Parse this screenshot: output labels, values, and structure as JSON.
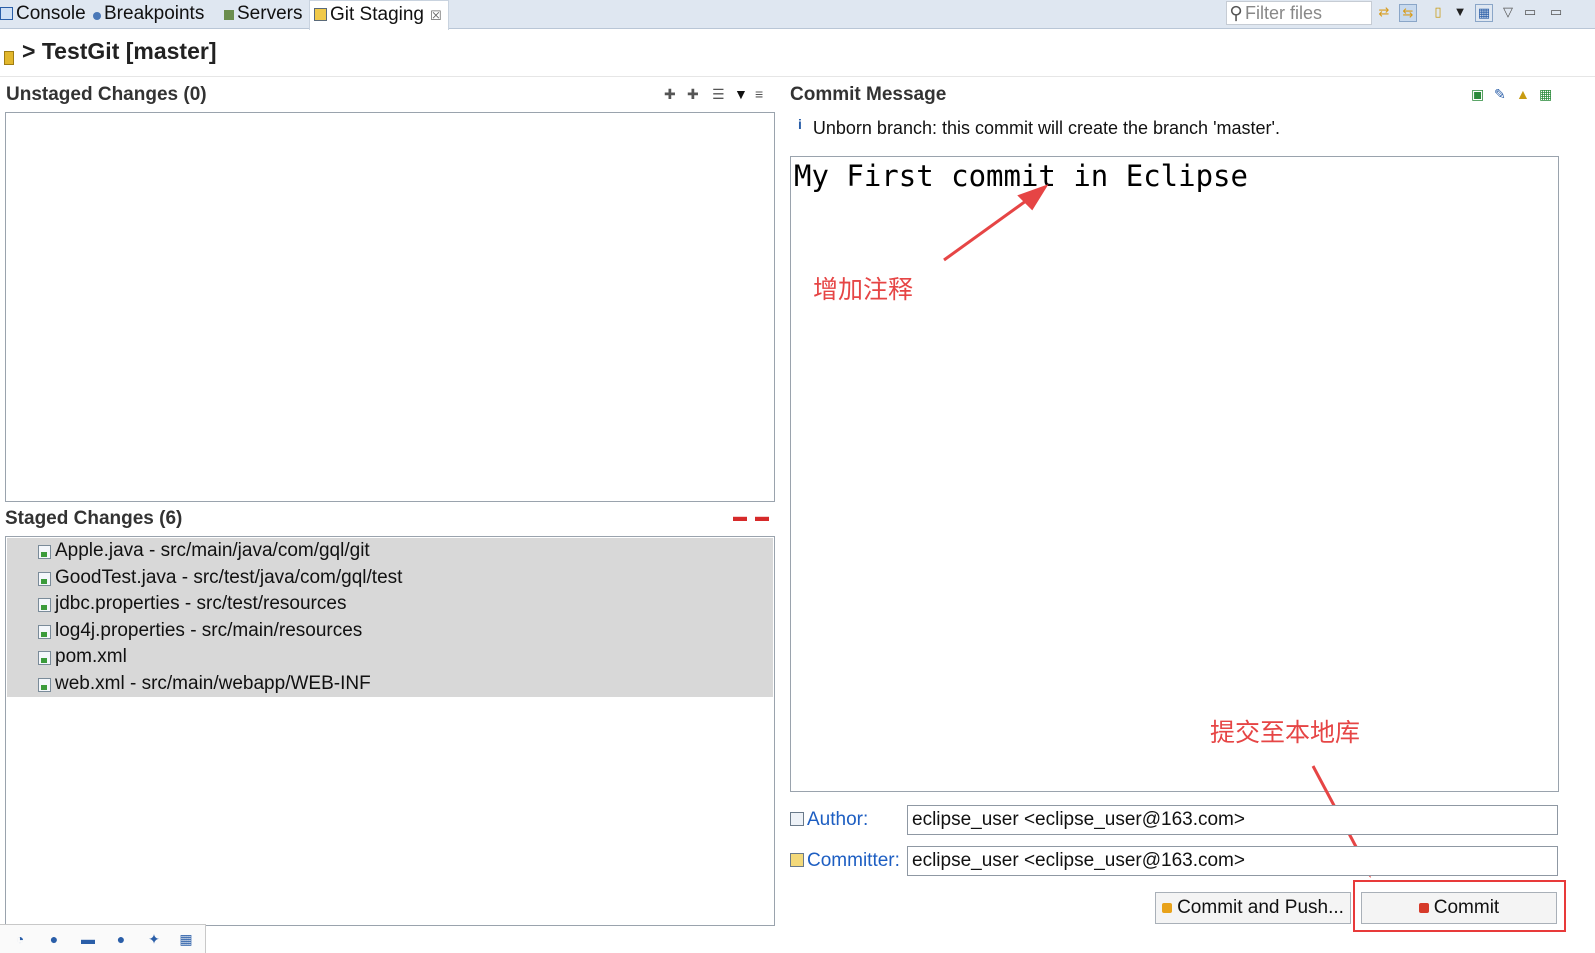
{
  "tabs": [
    {
      "label": "Console",
      "icon": "console-icon"
    },
    {
      "label": "Breakpoints",
      "icon": "breakpoints-icon"
    },
    {
      "label": "Servers",
      "icon": "servers-icon"
    },
    {
      "label": "Git Staging",
      "icon": "git-staging-icon",
      "active": true
    }
  ],
  "close_glyph": "☒",
  "filter": {
    "placeholder": "Filter files"
  },
  "repository": {
    "prefix": ">",
    "title": "TestGit [master]"
  },
  "unstaged": {
    "header": "Unstaged Changes (0)",
    "files": []
  },
  "staged": {
    "header": "Staged Changes (6)",
    "files": [
      "Apple.java - src/main/java/com/gql/git",
      "GoodTest.java - src/test/java/com/gql/test",
      "jdbc.properties - src/test/resources",
      "log4j.properties - src/main/resources",
      "pom.xml",
      "web.xml - src/main/webapp/WEB-INF"
    ]
  },
  "commit": {
    "header": "Commit Message",
    "info_icon": "i",
    "info": "Unborn branch: this commit will create the branch 'master'.",
    "message": "My First commit in Eclipse",
    "author_label": "Author:",
    "author": "eclipse_user <eclipse_user@163.com>",
    "committer_label": "Committer:",
    "committer": "eclipse_user <eclipse_user@163.com>",
    "commit_and_push_label": "Commit and Push...",
    "commit_label": "Commit"
  },
  "annotations": {
    "add_comment": "增加注释",
    "commit_to_local": "提交至本地库"
  },
  "colors": {
    "annotation": "#e64545",
    "label_blue": "#1d5ec2",
    "tabbar_bg": "#dfe7f1",
    "selected_rows_bg": "#d8d8d8"
  }
}
